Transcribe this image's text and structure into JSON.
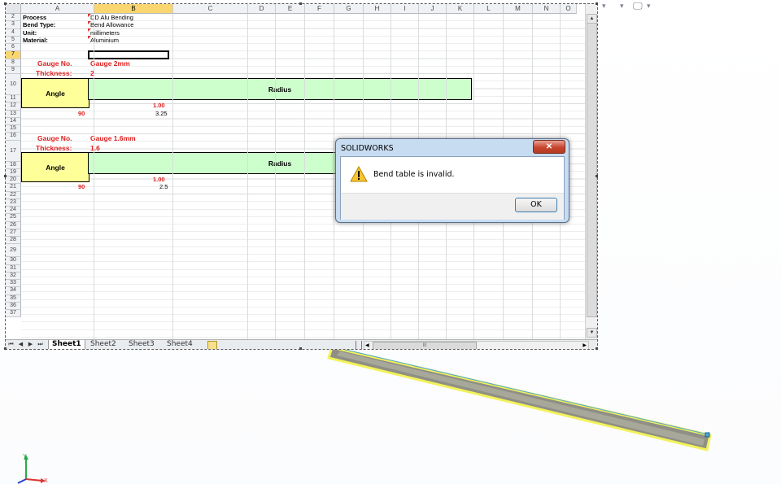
{
  "spreadsheet": {
    "columns": [
      "A",
      "B",
      "C",
      "D",
      "E",
      "F",
      "G",
      "H",
      "I",
      "J",
      "K",
      "L",
      "M",
      "N",
      "O"
    ],
    "selected_column": "B",
    "rows": [
      "2",
      "3",
      "4",
      "5",
      "6",
      "7",
      "8",
      "9",
      "10",
      "11",
      "12",
      "13",
      "14",
      "15",
      "16",
      "17",
      "18",
      "19",
      "20",
      "21",
      "22",
      "23",
      "24",
      "25",
      "26",
      "27",
      "28",
      "29",
      "30",
      "31",
      "32",
      "33",
      "34",
      "35",
      "36",
      "37"
    ],
    "selected_row": "7",
    "header_info": [
      {
        "label": "Process",
        "value": "DD Alu Bending"
      },
      {
        "label": "Bend Type:",
        "value": "Bend Allowance"
      },
      {
        "label": "Unit:",
        "value": "millimeters"
      },
      {
        "label": "Material:",
        "value": "Aluminium"
      }
    ],
    "tables": [
      {
        "gauge_label": "Gauge No.",
        "gauge_value": "Gauge 2mm",
        "thickness_label": "Thickness:",
        "thickness_value": "2",
        "angle_header": "Angle",
        "radius_header": "Radius",
        "radius_value": "1.00",
        "angle_value": "90",
        "allowance": "3.25"
      },
      {
        "gauge_label": "Gauge No.",
        "gauge_value": "Gauge 1.6mm",
        "thickness_label": "Thickness:",
        "thickness_value": "1.6",
        "angle_header": "Angle",
        "radius_header": "Radius",
        "radius_value": "1.00",
        "angle_value": "90",
        "allowance": "2.5"
      }
    ],
    "sheet_tabs": [
      "Sheet1",
      "Sheet2",
      "Sheet3",
      "Sheet4"
    ],
    "active_sheet": "Sheet1",
    "hscroll_grip": "III"
  },
  "dialog": {
    "title": "SOLIDWORKS",
    "message": "Bend table is invalid.",
    "ok_label": "OK",
    "close_glyph": "✕",
    "icon": "warning-icon"
  },
  "triad": {
    "y_label": "Y",
    "x_label": "X"
  },
  "colors": {
    "angle_fill": "#ffff99",
    "radius_fill": "#ccffcc",
    "red_text": "#e02020",
    "part_highlight": "#f2f25a",
    "part_edge": "#4aa3df"
  }
}
